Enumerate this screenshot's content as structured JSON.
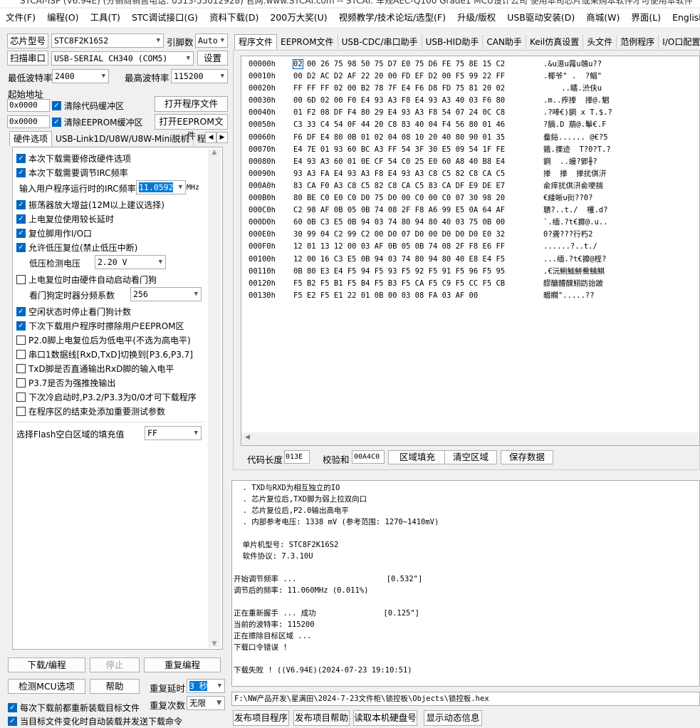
{
  "window": {
    "title": "STCAI-ISP (V6.94E) (分销商销售电话: 0513-55012928) 官网:www.STCAI.com  -- STCAI: 车规AEC-Q100 Grade1 MCU设计公司 使用本司芯片或采购本软件才可使用本软件"
  },
  "menu": [
    "文件(F)",
    "编程(O)",
    "工具(T)",
    "STC调试接口(G)",
    "资料下载(D)",
    "200万大奖(U)",
    "视频教学/技术论坛/选型(F)",
    "升级/版权",
    "USB驱动安装(D)",
    "商城(W)",
    "界面(L)",
    "English"
  ],
  "left": {
    "chip_label": "芯片型号",
    "chip_value": "STC8F2K16S2",
    "pin_label": "引脚数",
    "pin_value": "Auto",
    "scan_label": "扫描串口",
    "port_value": "USB-SERIAL CH340 (COM5)",
    "settings_label": "设置",
    "min_baud_label": "最低波特率",
    "min_baud_value": "2400",
    "max_baud_label": "最高波特率",
    "max_baud_value": "115200",
    "start_addr_label": "起始地址",
    "addr1": "0x0000",
    "clear_code_label": "清除代码缓冲区",
    "open_prog_label": "打开程序文件",
    "addr2": "0x0000",
    "clear_eeprom_label": "清除EEPROM缓冲区",
    "open_eeprom_label": "打开EEPROM文件",
    "tabs": [
      "硬件选项",
      "USB-Link1D/U8W/U8W-Mini脱机",
      "程序加"
    ],
    "options": {
      "o1": "本次下载需要修改硬件选项",
      "o2": "本次下载需要调节IRC频率",
      "irc_label": "输入用户程序运行时的IRC频率",
      "irc_value": "11.0592",
      "irc_unit": "MHz",
      "o3": "振荡器放大增益(12M以上建议选择)",
      "o4": "上电复位使用较长延时",
      "o5": "复位脚用作I/O口",
      "o6": "允许低压复位(禁止低压中断)",
      "lvd_label": "低压检测电压",
      "lvd_value": "2.20 V",
      "o7": "上电复位时由硬件自动启动看门狗",
      "wdt_label": "看门狗定时器分频系数",
      "wdt_value": "256",
      "o8": "空闲状态时停止看门狗计数",
      "o9": "下次下载用户程序时擦除用户EEPROM区",
      "o10": "P2.0脚上电复位后为低电平(不选为高电平)",
      "o11": "串口1数据线[RxD,TxD]切换到[P3.6,P3.7]",
      "o12": "TxD脚是否直通输出RxD脚的输入电平",
      "o13": "P3.7是否为强推挽输出",
      "o14": "下次冷启动时,P3.2/P3.3为0/0才可下载程序",
      "o15": "在程序区的结束处添加重要测试参数",
      "fill_label": "选择Flash空白区域的填充值",
      "fill_value": "FF"
    },
    "download_label": "下载/编程",
    "stop_label": "停止",
    "reprogram_label": "重复编程",
    "check_mcu_label": "检测MCU选项",
    "help_label": "帮助",
    "retry_delay_label": "重复延时",
    "retry_delay_value": "3 秒",
    "reload_label": "每次下载前都重新装载目标文件",
    "retry_count_label": "重复次数",
    "retry_count_value": "无限",
    "auto_label": "当目标文件变化时自动装载并发送下载命令"
  },
  "right": {
    "tabs": [
      "程序文件",
      "EEPROM文件",
      "USB-CDC/串口助手",
      "USB-HID助手",
      "CAN助手",
      "Keil仿真设置",
      "头文件",
      "范例程序",
      "I/O口配置工具"
    ],
    "hex_rows": [
      {
        "addr": "00000h",
        "hex": "02 00 26 75 98 50 75 D7 E0 75 D6 FE 75 8E 15 C2",
        "ascii": ".&u濨u霿u鵸u??"
      },
      {
        "addr": "00010h",
        "hex": "00 D2 AC D2 AF 22 20 00 FD EF D2 00 F5 99 22 FF",
        "ascii": ".椰爷\" .  ?鲳\""
      },
      {
        "addr": "00020h",
        "hex": "FF FF FF 02 00 B2 78 7F E4 F6 D8 FD 75 81 20 02",
        "ascii": "    ..瞲.渋伕u"
      },
      {
        "addr": "00030h",
        "hex": "00 6D 02 00 F0 E4 93 A3 F8 E4 93 A3 40 03 F6 80",
        "ascii": ".m..痄搼  搼@.魍"
      },
      {
        "addr": "00040h",
        "hex": "01 F2 08 DF F4 80 29 E4 93 A3 F8 54 07 24 0C C8",
        "ascii": ".?唪€)鋼 x T.$.?"
      },
      {
        "addr": "00050h",
        "hex": "C3 33 C4 54 0F 44 20 C8 83 40 04 F4 56 80 01 46",
        "ascii": "?腡.D 萠@.鬡€.F"
      },
      {
        "addr": "00060h",
        "hex": "F6 DF E4 80 0B 01 02 04 08 10 20 40 80 90 01 35",
        "ascii": "鲞鋊...... @€?5"
      },
      {
        "addr": "00070h",
        "hex": "E4 7E 01 93 60 BC A3 FF 54 3F 30 E5 09 54 1F FE",
        "ascii": "鋨.搮迹  T?0?T.?"
      },
      {
        "addr": "00080h",
        "hex": "E4 93 A3 60 01 0E CF 54 C0 25 E0 60 A8 40 B8 E4",
        "ascii": "鋼  ..蟃?鄋╫?"
      },
      {
        "addr": "00090h",
        "hex": "93 A3 FA E4 93 A3 F8 E4 93 A3 C8 C5 82 C8 CA C5",
        "ascii": "搼  搼  搼扰倛汧"
      },
      {
        "addr": "000A0h",
        "hex": "83 CA F0 A3 C8 C5 82 C8 CA C5 83 CA DF E9 DE E7",
        "ascii": "兪痒扰倛汧兪哽揣"
      },
      {
        "addr": "000B0h",
        "hex": "80 BE C0 E0 C0 D0 75 D0 00 C0 00 C0 07 30 98 20",
        "ascii": "€緌晰u衏??0?"
      },
      {
        "addr": "000C0h",
        "hex": "C2 98 AF 0B 05 0B 74 08 2F F8 A6 99 E5 0A 64 AF",
        "ascii": "聵?..t./  欔.d?"
      },
      {
        "addr": "000D0h",
        "hex": "60 0B C3 E5 0B 94 03 74 80 94 80 40 03 75 0B 00",
        "ascii": "`.缅.?t€攠@.u.."
      },
      {
        "addr": "000E0h",
        "hex": "30 99 04 C2 99 C2 00 D0 07 D0 00 D0 D0 D0 E0 32",
        "ascii": "0?聋???行朽2"
      },
      {
        "addr": "000F0h",
        "hex": "12 01 13 12 00 03 AF 0B 05 0B 74 08 2F F8 E6 FF",
        "ascii": "......?..t./"
      },
      {
        "addr": "00100h",
        "hex": "12 00 16 C3 E5 0B 94 03 74 80 94 80 40 E8 E4 F5",
        "ascii": "...缅.?t€攠@桎?"
      },
      {
        "addr": "00110h",
        "hex": "0B 80 E3 E4 F5 94 F5 93 F5 92 F5 91 F5 96 F5 95",
        "ascii": ".€沅鯏鮞鮩鮝鮧鯕"
      },
      {
        "addr": "00120h",
        "hex": "F5 B2 F5 B1 F5 B4 F5 B3 F5 CA F5 C9 F5 CC F5 CB",
        "ascii": "醪醣醴醭鮙趽詒跛"
      },
      {
        "addr": "00130h",
        "hex": "F5 E2 F5 E1 22 01 0B 00 03 08 FA 03 AF 00",
        "ascii": "畷瞷\".....??"
      }
    ],
    "code_len_label": "代码长度",
    "code_len_value": "013E",
    "checksum_label": "校验和",
    "checksum_value": "00A4C0",
    "fill_area_label": "区域填充",
    "clear_area_label": "清空区域",
    "save_data_label": "保存数据",
    "log": [
      "  . TXD与RXD为相互独立的IO",
      "  . 芯片复位后,TXD脚为弱上拉双向口",
      "  . 芯片复位后,P2.0输出高电平",
      "  . 内部参考电压: 1338 mV (参考范围: 1270~1410mV)",
      "",
      "  单片机型号: STC8F2K16S2",
      "  软件协议: 7.3.10U",
      "",
      "开始调节频率 ...                    [0.532\"]",
      "调节后的频率: 11.060MHz (0.011%)",
      "",
      "正在重新握手 ... 成功               [0.125\"]",
      "当前的波特率: 115200",
      "正在擦除目标区域 ...",
      "下载口令错误 !",
      "",
      "下载失败 ! ((V6.94E)(2024-07-23 19:10:51)"
    ],
    "path": "F:\\NW产品开发\\星满田\\2024-7-23文件柜\\锁控板\\Objects\\锁控板.hex",
    "bottom_buttons": [
      "发布项目程序",
      "发布项目帮助",
      "读取本机硬盘号",
      "显示动态信息"
    ]
  }
}
